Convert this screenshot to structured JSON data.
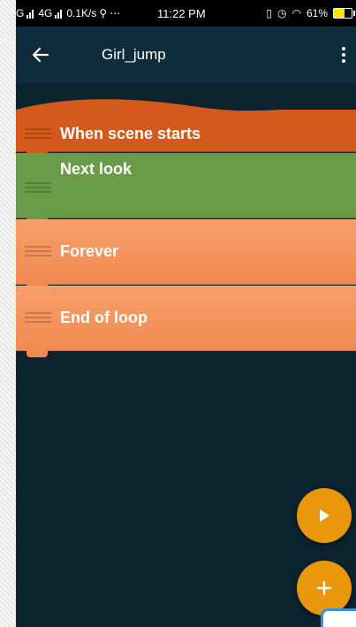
{
  "status_bar": {
    "left_text": "G",
    "net_label": "4G",
    "speed": "0.1K/s",
    "extra": "⋯",
    "time": "11:22 PM",
    "battery": "61%"
  },
  "app_bar": {
    "title": "Girl_jump",
    "back_icon": "arrow-left-icon",
    "menu_icon": "more-vert-icon"
  },
  "bricks": [
    {
      "label": "When scene starts",
      "color": "#d35a1c"
    },
    {
      "label": "Next look",
      "color": "#6a9b48"
    },
    {
      "label": "Forever",
      "color": "#f4915b"
    },
    {
      "label": "End of loop",
      "color": "#f4915b"
    }
  ],
  "fabs": {
    "play_icon": "play-icon",
    "add_icon": "plus-icon",
    "color": "#e8960a"
  }
}
